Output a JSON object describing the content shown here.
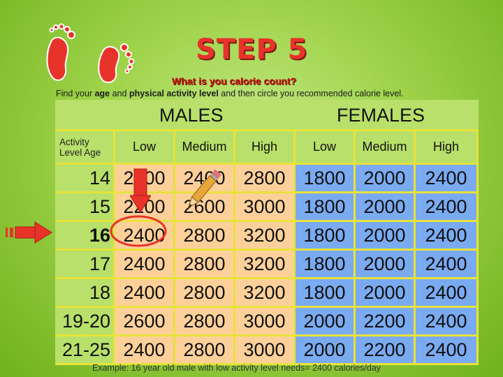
{
  "header": {
    "step_title": "STEP 5",
    "question": "What is you calorie count?",
    "instructions": {
      "part1": "Find your ",
      "age": "age",
      "part2": " and ",
      "activity": "physical activity level",
      "part3": " and then circle you recommended calorie level."
    }
  },
  "table": {
    "groups": {
      "males": "MALES",
      "females": "FEMALES"
    },
    "corner_label_line1": "Activity",
    "corner_label_line2": "Level Age",
    "columns": [
      "Low",
      "Medium",
      "High",
      "Low",
      "Medium",
      "High"
    ],
    "rows": [
      {
        "age": "14",
        "values": [
          "2000",
          "2400",
          "2800",
          "1800",
          "2000",
          "2400"
        ]
      },
      {
        "age": "15",
        "values": [
          "2200",
          "2600",
          "3000",
          "1800",
          "2000",
          "2400"
        ]
      },
      {
        "age": "16",
        "values": [
          "2400",
          "2800",
          "3200",
          "1800",
          "2000",
          "2400"
        ]
      },
      {
        "age": "17",
        "values": [
          "2400",
          "2800",
          "3200",
          "1800",
          "2000",
          "2400"
        ]
      },
      {
        "age": "18",
        "values": [
          "2400",
          "2800",
          "3200",
          "1800",
          "2000",
          "2400"
        ]
      },
      {
        "age": "19-20",
        "values": [
          "2600",
          "2800",
          "3000",
          "2000",
          "2200",
          "2400"
        ]
      },
      {
        "age": "21-25",
        "values": [
          "2400",
          "2800",
          "3000",
          "2000",
          "2200",
          "2400"
        ]
      }
    ]
  },
  "example": "Example: 16 year old male with low activity level needs= 2400 calories/day",
  "icons": {
    "feet": "red-footprints-icon",
    "down_arrow": "red-down-arrow-icon",
    "right_arrow": "red-right-arrow-icon",
    "pencil": "pencil-icon",
    "circle": "red-circle-highlight"
  },
  "colors": {
    "accent_red": "#e8332a",
    "male_cell": "#fdd09a",
    "female_cell": "#7aaaf0",
    "grid_line": "#e8e23a",
    "panel": "#b8e06a"
  }
}
